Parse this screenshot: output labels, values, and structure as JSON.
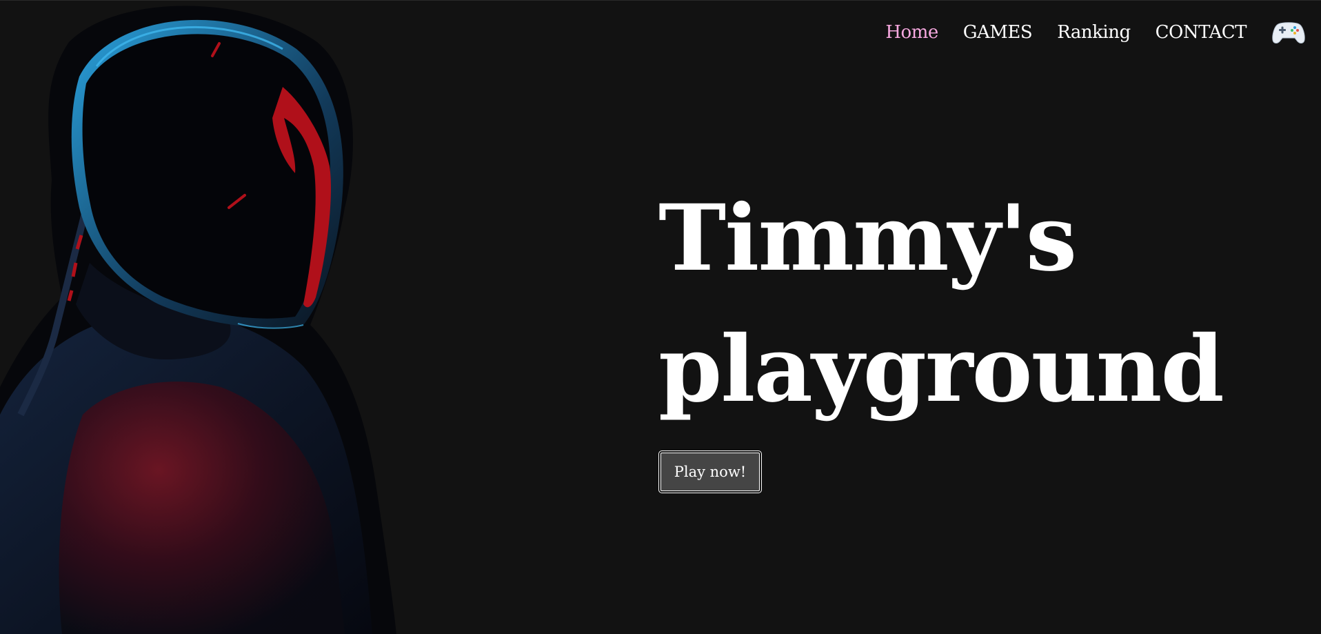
{
  "nav": {
    "items": [
      {
        "label": "Home",
        "active": true
      },
      {
        "label": "GAMES",
        "active": false
      },
      {
        "label": "Ranking",
        "active": false
      },
      {
        "label": "CONTACT",
        "active": false
      }
    ],
    "icon": "gamepad-icon",
    "active_color": "#f7a9e0"
  },
  "hero": {
    "title_line1": "Timmy's",
    "title_line2": "playground",
    "cta_label": "Play now!",
    "image": "masked-hero-figure"
  },
  "colors": {
    "background": "#121212",
    "text": "#ffffff",
    "button_bg": "#454545",
    "accent_red": "#b0101a",
    "accent_blue": "#2a9bd6"
  }
}
